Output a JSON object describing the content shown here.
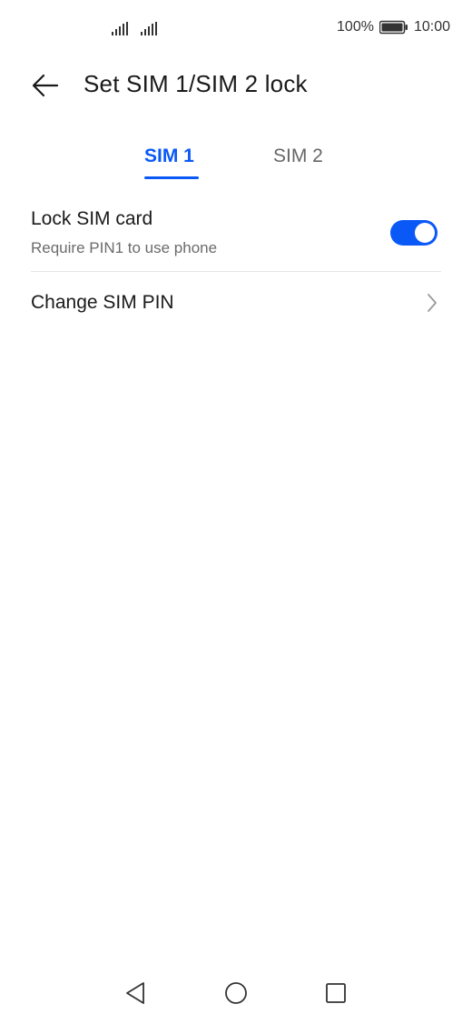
{
  "status_bar": {
    "battery_percent": "100%",
    "time": "10:00",
    "icons": [
      "signal-sim1-icon",
      "signal-sim2-icon",
      "battery-icon"
    ]
  },
  "header": {
    "title": "Set SIM 1/SIM 2 lock",
    "back_icon": "arrow-left-icon"
  },
  "tabs": [
    {
      "label": "SIM 1",
      "selected": true
    },
    {
      "label": "SIM 2",
      "selected": false
    }
  ],
  "settings": {
    "lock_sim": {
      "title": "Lock SIM card",
      "subtitle": "Require PIN1 to use phone",
      "enabled": true
    },
    "change_pin": {
      "title": "Change SIM PIN",
      "icon": "chevron-right-icon"
    }
  },
  "nav_bar": {
    "icons": [
      "nav-back-icon",
      "nav-home-icon",
      "nav-recent-icon"
    ]
  },
  "colors": {
    "accent": "#0a59f7",
    "text_primary": "#1a1a1a",
    "text_secondary": "#6b6b6b",
    "divider": "#e5e5e5",
    "background": "#ffffff"
  }
}
